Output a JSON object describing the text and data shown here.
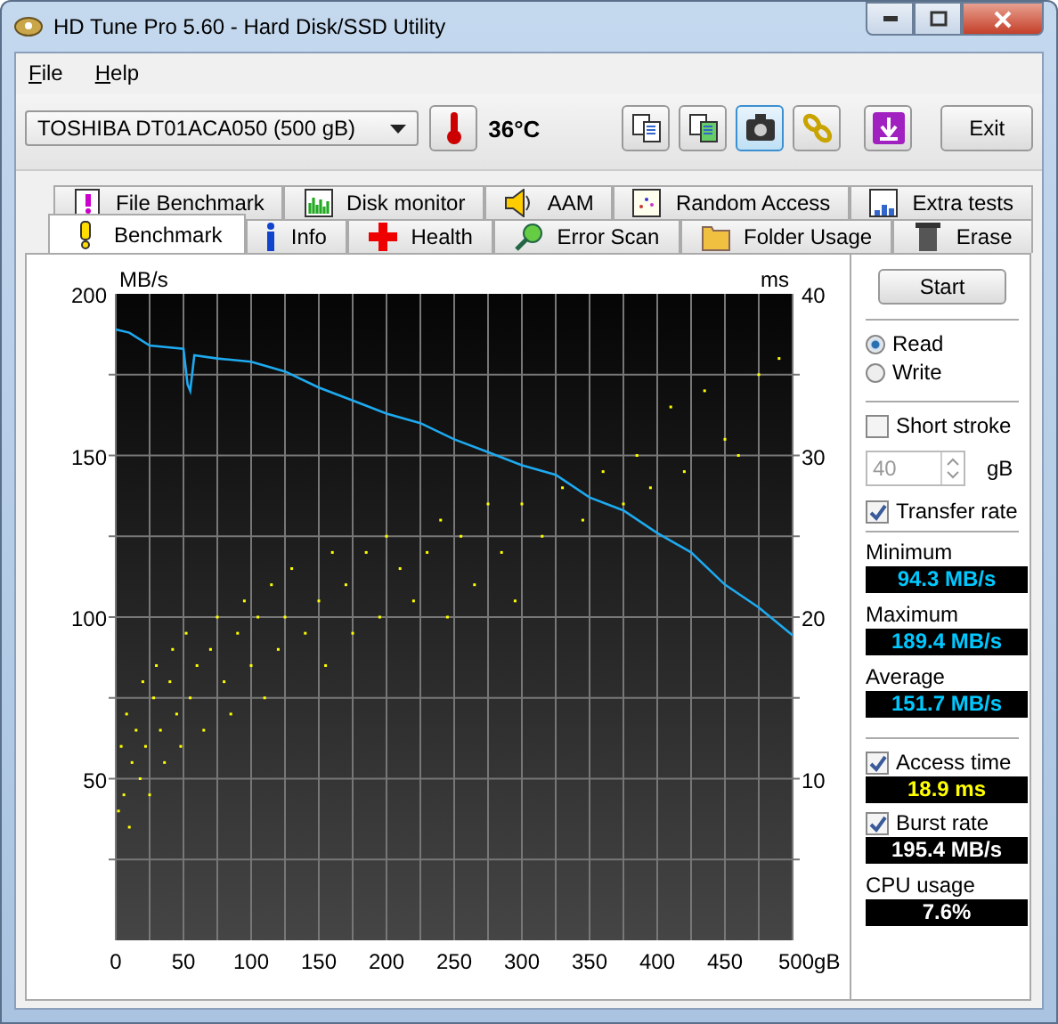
{
  "window": {
    "title": "HD Tune Pro 5.60 - Hard Disk/SSD Utility"
  },
  "menu": [
    {
      "label": "File"
    },
    {
      "label": "Help"
    }
  ],
  "toolbar": {
    "drive": "TOSHIBA DT01ACA050 (500 gB)",
    "temperature": "36°C",
    "tools": [
      {
        "selected": false
      },
      {
        "selected": false
      },
      {
        "selected": true
      },
      {
        "selected": false
      },
      {
        "selected": false
      }
    ],
    "exit": "Exit"
  },
  "tabs_top": [
    {
      "label": "File Benchmark",
      "selected": false
    },
    {
      "label": "Disk monitor",
      "selected": false
    },
    {
      "label": "AAM",
      "selected": false
    },
    {
      "label": "Random Access",
      "selected": false
    },
    {
      "label": "Extra tests",
      "selected": false
    }
  ],
  "tabs_bottom": [
    {
      "label": "Benchmark",
      "selected": true
    },
    {
      "label": "Info",
      "selected": false
    },
    {
      "label": "Health",
      "selected": false
    },
    {
      "label": "Error Scan",
      "selected": false
    },
    {
      "label": "Folder Usage",
      "selected": false
    },
    {
      "label": "Erase",
      "selected": false
    }
  ],
  "benchmark": {
    "chart_data": {
      "type": "line",
      "ylabel": "MB/s",
      "y2label": "ms",
      "xlim": [
        0,
        500
      ],
      "ylim": [
        0,
        200
      ],
      "y2lim": [
        0,
        40
      ],
      "grid": true,
      "xticks": [
        0,
        50,
        100,
        150,
        200,
        250,
        300,
        350,
        400,
        450,
        {
          "value": 500,
          "label": "500gB"
        }
      ],
      "yticks": [
        50,
        100,
        150,
        200
      ],
      "y2ticks": [
        10,
        20,
        30,
        40
      ],
      "series": [
        {
          "color": "#1eaaf0",
          "x": [
            0,
            10,
            25,
            50,
            53,
            55,
            58,
            75,
            100,
            125,
            150,
            175,
            200,
            225,
            250,
            275,
            300,
            325,
            350,
            375,
            400,
            425,
            450,
            475,
            500
          ],
          "values": [
            189,
            188,
            184,
            183,
            172,
            170,
            181,
            180,
            179,
            176,
            171,
            167,
            163,
            160,
            155,
            151,
            147,
            144,
            137,
            133,
            126,
            120,
            110,
            103,
            94.3
          ]
        },
        {
          "type": "scatter",
          "axis": "y2",
          "color": "#ffff00",
          "x": [
            2,
            4,
            6,
            8,
            10,
            12,
            15,
            18,
            20,
            22,
            25,
            28,
            30,
            33,
            36,
            40,
            42,
            45,
            48,
            52,
            55,
            60,
            65,
            70,
            75,
            80,
            85,
            90,
            95,
            100,
            105,
            110,
            115,
            120,
            125,
            130,
            140,
            150,
            155,
            160,
            170,
            175,
            185,
            195,
            200,
            210,
            220,
            230,
            240,
            245,
            255,
            265,
            275,
            285,
            295,
            300,
            315,
            330,
            345,
            360,
            375,
            385,
            395,
            410,
            420,
            435,
            450,
            460,
            475,
            490
          ],
          "values": [
            8,
            12,
            9,
            14,
            7,
            11,
            13,
            10,
            16,
            12,
            9,
            15,
            17,
            13,
            11,
            16,
            18,
            14,
            12,
            19,
            15,
            17,
            13,
            18,
            20,
            16,
            14,
            19,
            21,
            17,
            20,
            15,
            22,
            18,
            20,
            23,
            19,
            21,
            17,
            24,
            22,
            19,
            24,
            20,
            25,
            23,
            21,
            24,
            26,
            20,
            25,
            22,
            27,
            24,
            21,
            27,
            25,
            28,
            26,
            29,
            27,
            30,
            28,
            33,
            29,
            34,
            31,
            30,
            35,
            36
          ]
        }
      ]
    }
  },
  "panel": {
    "start": "Start",
    "modes": [
      {
        "label": "Read",
        "selected": true
      },
      {
        "label": "Write",
        "selected": false
      }
    ],
    "short_stroke": {
      "label": "Short stroke",
      "checked": false
    },
    "size": {
      "value": "40",
      "unit": "gB",
      "disabled": true
    },
    "transfer_rate": {
      "label": "Transfer rate",
      "checked": true
    },
    "stats": [
      {
        "label": "Minimum",
        "value": "94.3 MB/s"
      },
      {
        "label": "Maximum",
        "value": "189.4 MB/s"
      },
      {
        "label": "Average",
        "value": "151.7 MB/s"
      }
    ],
    "readouts": [
      {
        "kind": "checkbox",
        "label": "Access time",
        "checked": true,
        "value": "18.9 ms"
      },
      {
        "kind": "checkbox",
        "label": "Burst rate",
        "checked": true,
        "value": "195.4 MB/s"
      },
      {
        "kind": "label",
        "label": "CPU usage",
        "value": "7.6%"
      }
    ]
  }
}
